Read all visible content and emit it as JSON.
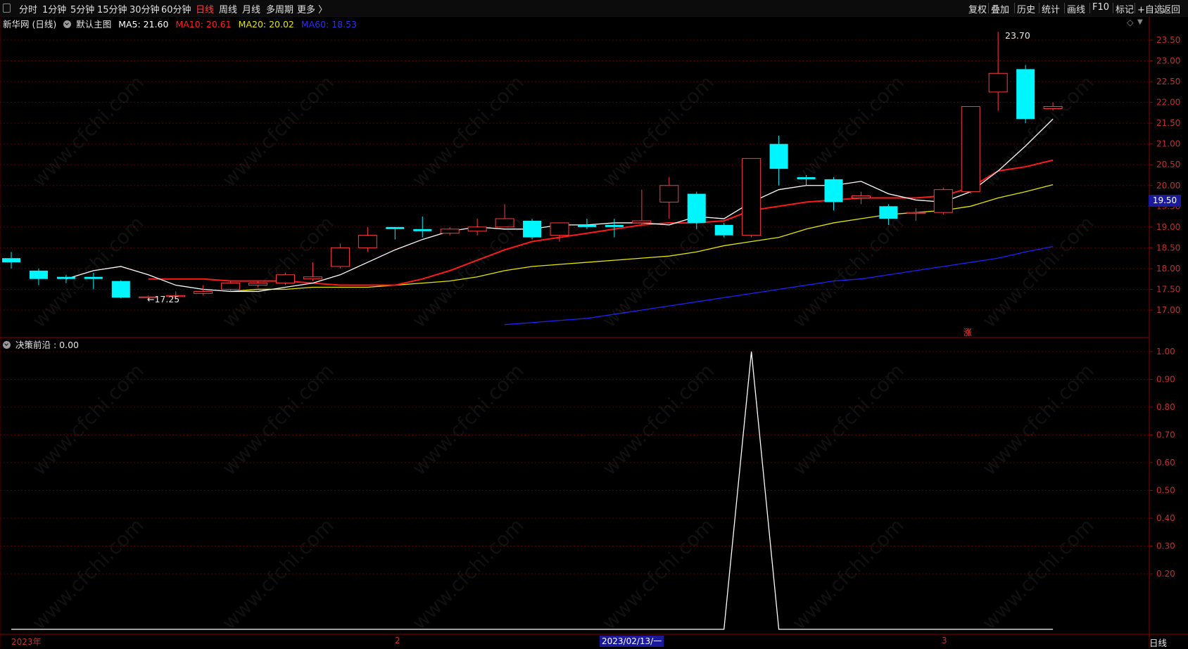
{
  "toolbar": {
    "left": [
      "分时",
      "1分钟",
      "5分钟",
      "15分钟",
      "30分钟",
      "60分钟",
      "日线",
      "周线",
      "月线",
      "多周期",
      "更多 〉"
    ],
    "active": "日线",
    "right": [
      "复权",
      "叠加",
      "历史",
      "统计",
      "画线",
      "F10",
      "标记",
      "+自选",
      "返回"
    ]
  },
  "header": {
    "stock": "新华网 (日线)",
    "template": "默认主图",
    "ma5": "MA5: 21.60",
    "ma10": "MA10: 20.61",
    "ma20": "MA20: 20.02",
    "ma60": "MA60: 18.53",
    "diamond": "◇",
    "caret": "▼"
  },
  "indicator": {
    "label": "决策前沿 : 0.00"
  },
  "markers": {
    "high": "23.70",
    "low": "←17.25",
    "zhang": "涨"
  },
  "price_tag": "19.50",
  "date_tag": "2023/02/13/一",
  "x_labels": {
    "year": "2023年",
    "feb": "2",
    "mar": "3"
  },
  "bottom_right": "日线",
  "watermark": "www.cfchi.com",
  "colors": {
    "up": "#ff3b3b",
    "down": "#00f6ff",
    "ma5": "#ffffff",
    "ma10": "#ff1a1a",
    "ma20": "#e6e600",
    "ma60": "#2020ff",
    "grid": "#5a0000"
  },
  "chart_data": [
    {
      "type": "candlestick",
      "title": "新华网 (日线)",
      "ylim": [
        16.6,
        23.9
      ],
      "yticks": [
        17.0,
        17.5,
        18.0,
        18.5,
        19.0,
        19.5,
        20.0,
        20.5,
        21.0,
        21.5,
        22.0,
        22.5,
        23.0,
        23.5
      ],
      "candles": [
        {
          "o": 18.25,
          "c": 18.15,
          "h": 18.4,
          "l": 18.0
        },
        {
          "o": 17.95,
          "c": 17.75,
          "h": 18.0,
          "l": 17.6
        },
        {
          "o": 17.8,
          "c": 17.75,
          "h": 17.85,
          "l": 17.65
        },
        {
          "o": 17.8,
          "c": 17.75,
          "h": 17.9,
          "l": 17.5
        },
        {
          "o": 17.7,
          "c": 17.3,
          "h": 17.72,
          "l": 17.28
        },
        {
          "o": 17.3,
          "c": 17.32,
          "h": 17.35,
          "l": 17.25
        },
        {
          "o": 17.35,
          "c": 17.35,
          "h": 17.45,
          "l": 17.25
        },
        {
          "o": 17.4,
          "c": 17.45,
          "h": 17.6,
          "l": 17.35
        },
        {
          "o": 17.5,
          "c": 17.65,
          "h": 17.7,
          "l": 17.45
        },
        {
          "o": 17.6,
          "c": 17.65,
          "h": 17.7,
          "l": 17.55
        },
        {
          "o": 17.65,
          "c": 17.85,
          "h": 17.9,
          "l": 17.6
        },
        {
          "o": 17.75,
          "c": 17.8,
          "h": 18.15,
          "l": 17.7
        },
        {
          "o": 18.05,
          "c": 18.5,
          "h": 18.6,
          "l": 18.0
        },
        {
          "o": 18.5,
          "c": 18.8,
          "h": 19.0,
          "l": 18.4
        },
        {
          "o": 19.0,
          "c": 18.95,
          "h": 19.0,
          "l": 18.7
        },
        {
          "o": 18.95,
          "c": 18.9,
          "h": 19.25,
          "l": 18.75
        },
        {
          "o": 18.85,
          "c": 18.95,
          "h": 19.0,
          "l": 18.8
        },
        {
          "o": 18.9,
          "c": 19.0,
          "h": 19.2,
          "l": 18.8
        },
        {
          "o": 19.0,
          "c": 19.2,
          "h": 19.55,
          "l": 19.0
        },
        {
          "o": 19.15,
          "c": 18.75,
          "h": 19.2,
          "l": 18.7
        },
        {
          "o": 18.8,
          "c": 19.1,
          "h": 19.1,
          "l": 18.65
        },
        {
          "o": 19.05,
          "c": 19.0,
          "h": 19.2,
          "l": 18.95
        },
        {
          "o": 19.05,
          "c": 19.0,
          "h": 19.2,
          "l": 18.75
        },
        {
          "o": 19.1,
          "c": 19.15,
          "h": 19.9,
          "l": 19.05
        },
        {
          "o": 19.6,
          "c": 20.0,
          "h": 20.2,
          "l": 19.2
        },
        {
          "o": 19.8,
          "c": 19.1,
          "h": 19.85,
          "l": 18.95
        },
        {
          "o": 19.05,
          "c": 18.8,
          "h": 19.1,
          "l": 18.75
        },
        {
          "o": 18.8,
          "c": 20.65,
          "h": 20.65,
          "l": 18.75
        },
        {
          "o": 21.0,
          "c": 20.4,
          "h": 21.2,
          "l": 20.0
        },
        {
          "o": 20.2,
          "c": 20.15,
          "h": 20.25,
          "l": 20.0
        },
        {
          "o": 20.15,
          "c": 19.6,
          "h": 20.2,
          "l": 19.4
        },
        {
          "o": 19.7,
          "c": 19.75,
          "h": 19.85,
          "l": 19.55
        },
        {
          "o": 19.5,
          "c": 19.2,
          "h": 19.55,
          "l": 19.05
        },
        {
          "o": 19.35,
          "c": 19.35,
          "h": 19.45,
          "l": 19.15
        },
        {
          "o": 19.35,
          "c": 19.9,
          "h": 19.95,
          "l": 19.3
        },
        {
          "o": 19.85,
          "c": 21.9,
          "h": 21.9,
          "l": 19.8
        },
        {
          "o": 22.25,
          "c": 22.7,
          "h": 23.7,
          "l": 21.8
        },
        {
          "o": 22.8,
          "c": 21.6,
          "h": 22.9,
          "l": 21.5
        },
        {
          "o": 21.85,
          "c": 21.9,
          "h": 22.0,
          "l": 21.8
        }
      ],
      "ma5": [
        17.75,
        17.95,
        18.05,
        17.85,
        17.6,
        17.5,
        17.45,
        17.45,
        17.55,
        17.65,
        17.85,
        18.15,
        18.45,
        18.7,
        18.9,
        19.0,
        18.95,
        18.95,
        19.05,
        19.05,
        19.1,
        19.1,
        19.05,
        19.25,
        19.2,
        19.6,
        19.9,
        20.0,
        20.0,
        20.1,
        19.8,
        19.65,
        19.6,
        19.85,
        20.35,
        20.95,
        21.6
      ],
      "ma10": [
        17.75,
        17.75,
        17.75,
        17.7,
        17.7,
        17.7,
        17.65,
        17.6,
        17.6,
        17.6,
        17.75,
        17.95,
        18.2,
        18.45,
        18.65,
        18.75,
        18.85,
        18.95,
        19.05,
        19.1,
        19.1,
        19.15,
        19.4,
        19.5,
        19.6,
        19.65,
        19.7,
        19.7,
        19.7,
        19.75,
        19.95,
        20.35,
        20.45,
        20.61
      ],
      "ma20": [
        17.45,
        17.5,
        17.5,
        17.55,
        17.55,
        17.55,
        17.6,
        17.65,
        17.7,
        17.8,
        17.95,
        18.05,
        18.1,
        18.15,
        18.2,
        18.25,
        18.3,
        18.4,
        18.55,
        18.65,
        18.75,
        18.95,
        19.1,
        19.2,
        19.3,
        19.35,
        19.4,
        19.5,
        19.7,
        19.85,
        20.02
      ],
      "ma60": [
        16.65,
        16.7,
        16.75,
        16.8,
        16.9,
        17.0,
        17.1,
        17.2,
        17.3,
        17.4,
        17.5,
        17.6,
        17.7,
        17.75,
        17.85,
        17.95,
        18.05,
        18.15,
        18.25,
        18.4,
        18.53
      ]
    },
    {
      "type": "line",
      "title": "决策前沿",
      "ylim": [
        0,
        1.0
      ],
      "yticks": [
        0.2,
        0.3,
        0.4,
        0.5,
        0.6,
        0.7,
        0.8,
        0.9,
        1.0
      ],
      "values": [
        0,
        0,
        0,
        0,
        0,
        0,
        0,
        0,
        0,
        0,
        0,
        0,
        0,
        0,
        0,
        0,
        0,
        0,
        0,
        0,
        0,
        0,
        0,
        0,
        0,
        0,
        0,
        1,
        0,
        0,
        0,
        0,
        0,
        0,
        0,
        0,
        0,
        0,
        0
      ]
    }
  ]
}
